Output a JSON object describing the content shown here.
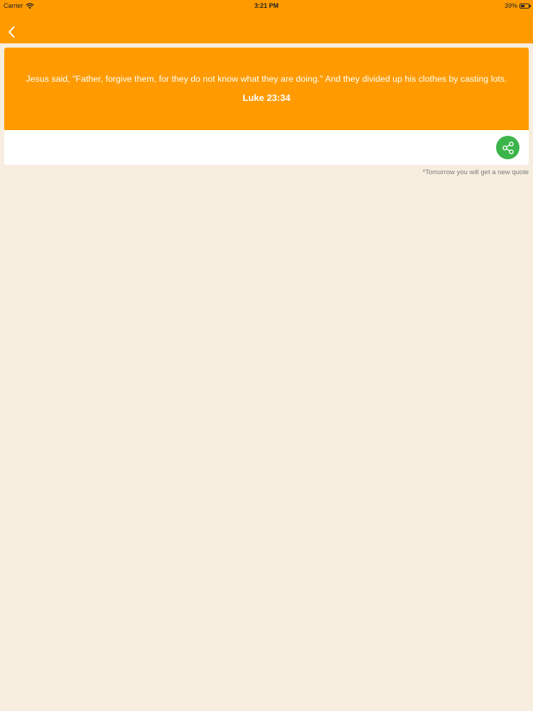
{
  "status_bar": {
    "carrier": "Carrier",
    "time": "3:21 PM",
    "battery": "39%",
    "battery_level_percent": 39
  },
  "nav": {
    "back_icon": "chevron-left-icon"
  },
  "quote": {
    "text": "Jesus said, \"Father, forgive them, for they do not know what they are doing.\" And they divided up his clothes by casting lots.",
    "reference": "Luke 23:34",
    "share_icon": "share-icon"
  },
  "footnote": "*Tomorrow you will get a new quote",
  "colors": {
    "accent": "#ff9b00",
    "background": "#f7eee0",
    "share": "#3bb44a"
  }
}
